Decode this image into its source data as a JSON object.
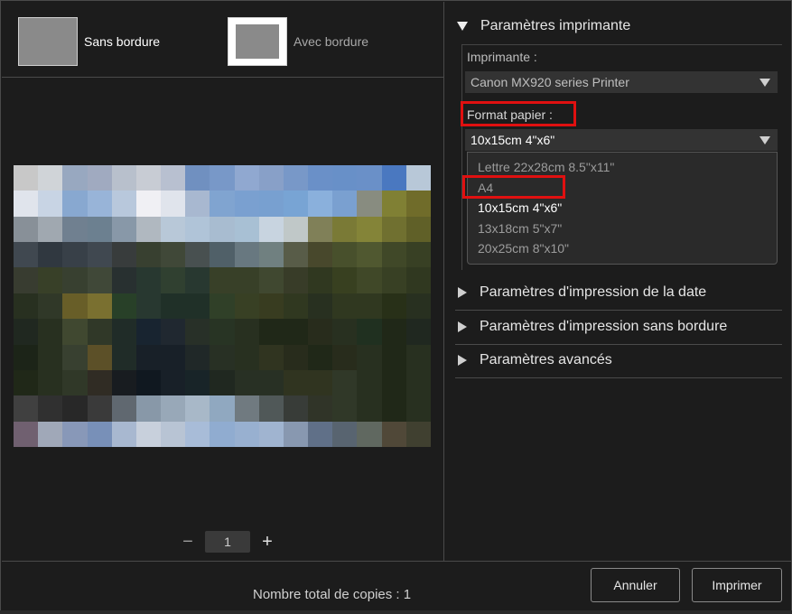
{
  "layout": {
    "borderless_label": "Sans bordure",
    "bordered_label": "Avec bordure"
  },
  "copies_stepper": {
    "minus": "−",
    "value": "1",
    "plus": "+"
  },
  "printer_settings": {
    "title": "Paramètres imprimante",
    "printer_label": "Imprimante :",
    "printer_value": "Canon MX920 series Printer",
    "paper_label": "Format papier :",
    "paper_value": "10x15cm 4\"x6\"",
    "paper_options": [
      "Lettre 22x28cm 8.5\"x11\"",
      "A4",
      "10x15cm 4\"x6\"",
      "13x18cm 5\"x7\"",
      "20x25cm 8\"x10\""
    ],
    "selected_option": "10x15cm 4\"x6\""
  },
  "sections": {
    "date_print": "Paramètres d'impression de la date",
    "borderless_print": "Paramètres d'impression sans bordure",
    "advanced": "Paramètres avancés"
  },
  "footer": {
    "total_copies": "Nombre total de copies : 1",
    "cancel": "Annuler",
    "print": "Imprimer"
  },
  "colors": {
    "background": "#1c1c1c",
    "highlight": "#e01010"
  }
}
